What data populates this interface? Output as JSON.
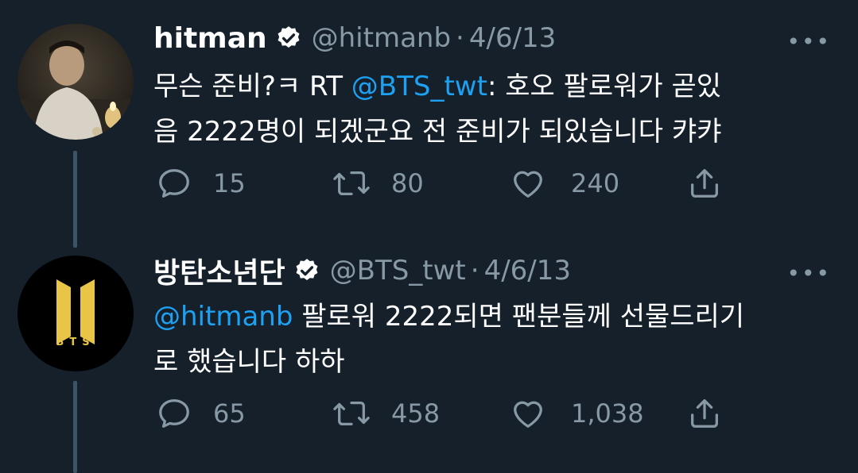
{
  "tweets": [
    {
      "name": "hitman",
      "handle": "@hitmanb",
      "separator": "·",
      "date": "4/6/13",
      "more": "•••",
      "text": {
        "line1_pre": "무슨 준비?ㅋ RT ",
        "line1_mention": "@BTS_twt",
        "line1_post": ": 호오 팔로워가 곧있",
        "line2": "음 2222명이 되겠군요 전 준비가 되있습니다 캬캬"
      },
      "replies": "15",
      "retweets": "80",
      "likes": "240",
      "avatar_icon": "user-photo"
    },
    {
      "name": "방탄소년단",
      "handle": "@BTS_twt",
      "separator": "·",
      "date": "4/6/13",
      "more": "•••",
      "text": {
        "line1_mention": "@hitmanb",
        "line1_post": " 팔로워 2222되면 팬분들께 선물드리기",
        "line2": "로 했습니다 하하"
      },
      "replies": "65",
      "retweets": "458",
      "likes": "1,038",
      "avatar_icon": "bts-logo",
      "logo_text": "BTS"
    }
  ],
  "colors": {
    "background": "#15202b",
    "text": "#ffffff",
    "secondary": "#8899a6",
    "link": "#1da1f2",
    "thread_line": "#3d5466",
    "logo_gold": "#e8c547"
  },
  "icons": [
    "reply-icon",
    "retweet-icon",
    "like-icon",
    "share-icon",
    "verified-icon",
    "more-icon"
  ]
}
